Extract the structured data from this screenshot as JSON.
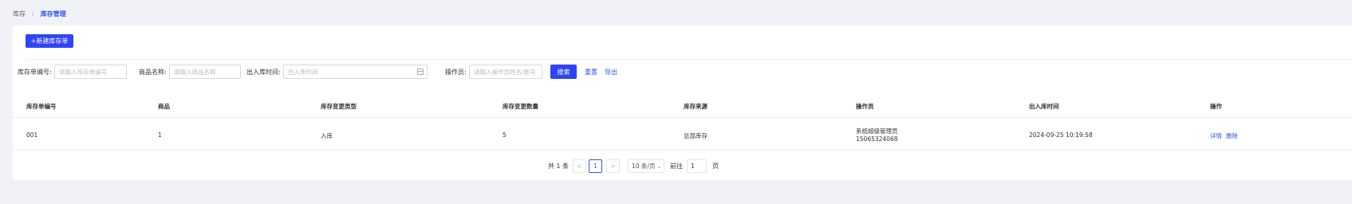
{
  "breadcrumb": {
    "parent": "库存",
    "separator": "/",
    "current": "库存管理"
  },
  "actions": {
    "new_button": "+新建库存单"
  },
  "filters": {
    "order_no_label": "库存单编号:",
    "order_no_placeholder": "请输入库存单编号",
    "product_label": "商品名称:",
    "product_placeholder": "请输入商品名称",
    "time_label": "出入库时间:",
    "time_placeholder": "出入库时间",
    "operator_label": "操作员:",
    "operator_placeholder": "请输入操作员姓名/账号",
    "search_button": "搜索",
    "reset_link": "重置",
    "export_link": "导出"
  },
  "table": {
    "columns": [
      "库存单编号",
      "商品",
      "库存变更类型",
      "库存变更数量",
      "库存来源",
      "操作员",
      "出入库时间",
      "操作"
    ],
    "rows": [
      {
        "order_no": "001",
        "product": "1",
        "change_type": "入库",
        "quantity": "5",
        "source": "总部库存",
        "operator_name": "系统超级管理员",
        "operator_account": "15065324068",
        "time": "2024-09-25 10:19:58",
        "detail_link": "详情",
        "delete_link": "删除"
      }
    ]
  },
  "pagination": {
    "total_text": "共 1 条",
    "prev": "<",
    "current_page": "1",
    "next": ">",
    "page_size": "10 条/页",
    "goto_label": "前往",
    "goto_value": "1",
    "page_unit": "页"
  },
  "colors": {
    "accent": "#2f54eb",
    "primary_button": "#2f44f5",
    "background": "#f0f2f5"
  }
}
